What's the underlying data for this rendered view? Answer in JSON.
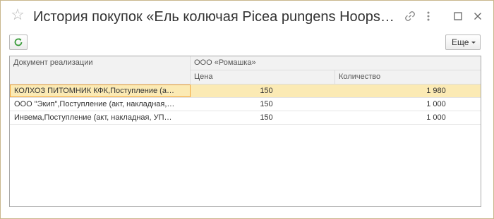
{
  "window": {
    "title": "История покупок «Ель колючая Picea pungens Hoops…"
  },
  "toolbar": {
    "more_label": "Еще"
  },
  "table": {
    "columns": {
      "document": "Документ реализации",
      "group": "ООО «Ромашка»",
      "price": "Цена",
      "quantity": "Количество"
    },
    "rows": [
      {
        "document": "КОЛХОЗ ПИТОМНИК КФК,Поступление (а…",
        "price": "150",
        "quantity": "1 980"
      },
      {
        "document": "ООО \"Экип\",Поступление (акт, накладная,…",
        "price": "150",
        "quantity": "1 000"
      },
      {
        "document": "Инвема,Поступление (акт, накладная, УП…",
        "price": "150",
        "quantity": "1 000"
      }
    ]
  },
  "colors": {
    "accent": "#fbeab4",
    "focus_border": "#f3a63b",
    "refresh_green": "#3a9c3a"
  }
}
